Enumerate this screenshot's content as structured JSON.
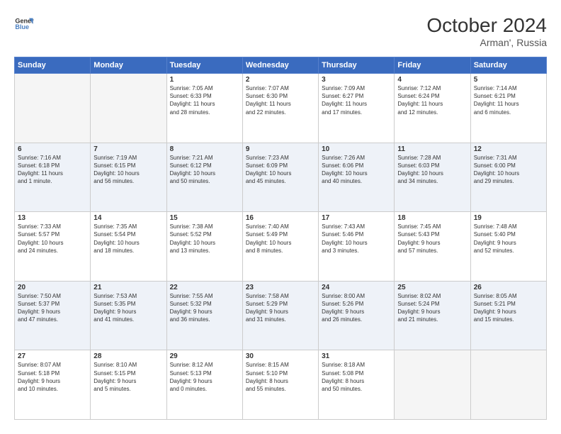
{
  "header": {
    "logo_line1": "General",
    "logo_line2": "Blue",
    "month": "October 2024",
    "location": "Arman', Russia"
  },
  "weekdays": [
    "Sunday",
    "Monday",
    "Tuesday",
    "Wednesday",
    "Thursday",
    "Friday",
    "Saturday"
  ],
  "weeks": [
    [
      {
        "day": "",
        "info": ""
      },
      {
        "day": "",
        "info": ""
      },
      {
        "day": "1",
        "info": "Sunrise: 7:05 AM\nSunset: 6:33 PM\nDaylight: 11 hours\nand 28 minutes."
      },
      {
        "day": "2",
        "info": "Sunrise: 7:07 AM\nSunset: 6:30 PM\nDaylight: 11 hours\nand 22 minutes."
      },
      {
        "day": "3",
        "info": "Sunrise: 7:09 AM\nSunset: 6:27 PM\nDaylight: 11 hours\nand 17 minutes."
      },
      {
        "day": "4",
        "info": "Sunrise: 7:12 AM\nSunset: 6:24 PM\nDaylight: 11 hours\nand 12 minutes."
      },
      {
        "day": "5",
        "info": "Sunrise: 7:14 AM\nSunset: 6:21 PM\nDaylight: 11 hours\nand 6 minutes."
      }
    ],
    [
      {
        "day": "6",
        "info": "Sunrise: 7:16 AM\nSunset: 6:18 PM\nDaylight: 11 hours\nand 1 minute."
      },
      {
        "day": "7",
        "info": "Sunrise: 7:19 AM\nSunset: 6:15 PM\nDaylight: 10 hours\nand 56 minutes."
      },
      {
        "day": "8",
        "info": "Sunrise: 7:21 AM\nSunset: 6:12 PM\nDaylight: 10 hours\nand 50 minutes."
      },
      {
        "day": "9",
        "info": "Sunrise: 7:23 AM\nSunset: 6:09 PM\nDaylight: 10 hours\nand 45 minutes."
      },
      {
        "day": "10",
        "info": "Sunrise: 7:26 AM\nSunset: 6:06 PM\nDaylight: 10 hours\nand 40 minutes."
      },
      {
        "day": "11",
        "info": "Sunrise: 7:28 AM\nSunset: 6:03 PM\nDaylight: 10 hours\nand 34 minutes."
      },
      {
        "day": "12",
        "info": "Sunrise: 7:31 AM\nSunset: 6:00 PM\nDaylight: 10 hours\nand 29 minutes."
      }
    ],
    [
      {
        "day": "13",
        "info": "Sunrise: 7:33 AM\nSunset: 5:57 PM\nDaylight: 10 hours\nand 24 minutes."
      },
      {
        "day": "14",
        "info": "Sunrise: 7:35 AM\nSunset: 5:54 PM\nDaylight: 10 hours\nand 18 minutes."
      },
      {
        "day": "15",
        "info": "Sunrise: 7:38 AM\nSunset: 5:52 PM\nDaylight: 10 hours\nand 13 minutes."
      },
      {
        "day": "16",
        "info": "Sunrise: 7:40 AM\nSunset: 5:49 PM\nDaylight: 10 hours\nand 8 minutes."
      },
      {
        "day": "17",
        "info": "Sunrise: 7:43 AM\nSunset: 5:46 PM\nDaylight: 10 hours\nand 3 minutes."
      },
      {
        "day": "18",
        "info": "Sunrise: 7:45 AM\nSunset: 5:43 PM\nDaylight: 9 hours\nand 57 minutes."
      },
      {
        "day": "19",
        "info": "Sunrise: 7:48 AM\nSunset: 5:40 PM\nDaylight: 9 hours\nand 52 minutes."
      }
    ],
    [
      {
        "day": "20",
        "info": "Sunrise: 7:50 AM\nSunset: 5:37 PM\nDaylight: 9 hours\nand 47 minutes."
      },
      {
        "day": "21",
        "info": "Sunrise: 7:53 AM\nSunset: 5:35 PM\nDaylight: 9 hours\nand 41 minutes."
      },
      {
        "day": "22",
        "info": "Sunrise: 7:55 AM\nSunset: 5:32 PM\nDaylight: 9 hours\nand 36 minutes."
      },
      {
        "day": "23",
        "info": "Sunrise: 7:58 AM\nSunset: 5:29 PM\nDaylight: 9 hours\nand 31 minutes."
      },
      {
        "day": "24",
        "info": "Sunrise: 8:00 AM\nSunset: 5:26 PM\nDaylight: 9 hours\nand 26 minutes."
      },
      {
        "day": "25",
        "info": "Sunrise: 8:02 AM\nSunset: 5:24 PM\nDaylight: 9 hours\nand 21 minutes."
      },
      {
        "day": "26",
        "info": "Sunrise: 8:05 AM\nSunset: 5:21 PM\nDaylight: 9 hours\nand 15 minutes."
      }
    ],
    [
      {
        "day": "27",
        "info": "Sunrise: 8:07 AM\nSunset: 5:18 PM\nDaylight: 9 hours\nand 10 minutes."
      },
      {
        "day": "28",
        "info": "Sunrise: 8:10 AM\nSunset: 5:15 PM\nDaylight: 9 hours\nand 5 minutes."
      },
      {
        "day": "29",
        "info": "Sunrise: 8:12 AM\nSunset: 5:13 PM\nDaylight: 9 hours\nand 0 minutes."
      },
      {
        "day": "30",
        "info": "Sunrise: 8:15 AM\nSunset: 5:10 PM\nDaylight: 8 hours\nand 55 minutes."
      },
      {
        "day": "31",
        "info": "Sunrise: 8:18 AM\nSunset: 5:08 PM\nDaylight: 8 hours\nand 50 minutes."
      },
      {
        "day": "",
        "info": ""
      },
      {
        "day": "",
        "info": ""
      }
    ]
  ]
}
